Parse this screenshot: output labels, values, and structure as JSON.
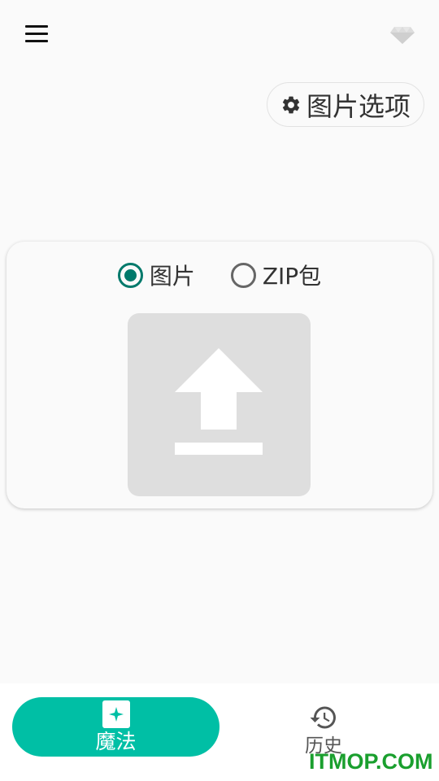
{
  "topbar": {
    "menu_icon": "hamburger-menu-icon",
    "premium_icon": "diamond-icon"
  },
  "options": {
    "label": "图片选项",
    "icon": "gear-icon"
  },
  "upload_card": {
    "mode_options": [
      {
        "label": "图片",
        "selected": true
      },
      {
        "label": "ZIP包",
        "selected": false
      }
    ],
    "upload_icon": "upload-icon"
  },
  "bottom_nav": {
    "items": [
      {
        "label": "魔法",
        "icon": "magic-sparkle-icon",
        "active": true
      },
      {
        "label": "历史",
        "icon": "history-icon",
        "active": false
      }
    ]
  },
  "watermark": "ITMOP.COM",
  "colors": {
    "accent": "#00bfa5",
    "radio_selected": "#00796b",
    "watermark": "#1a9f2e"
  }
}
